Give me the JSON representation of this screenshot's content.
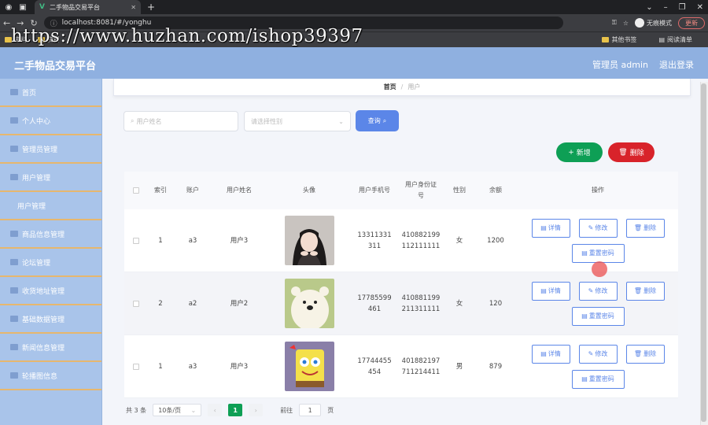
{
  "browser": {
    "tab_title": "二手物品交易平台",
    "url": "localhost:8081/#/yonghu",
    "incognito_label": "无痕模式",
    "update_label": "更新",
    "bookmarks": [
      "资料",
      "资料"
    ],
    "bookmarks_right": [
      "其他书签",
      "阅读清单"
    ]
  },
  "watermark": "https://www.huzhan.com/ishop39397",
  "header": {
    "brand": "二手物品交易平台",
    "user": "管理员 admin",
    "logout": "退出登录"
  },
  "sidebar": {
    "items": [
      {
        "label": "首页",
        "icon": "home-icon"
      },
      {
        "label": "个人中心",
        "icon": "user-icon"
      },
      {
        "label": "管理员管理",
        "icon": "admin-icon"
      },
      {
        "label": "用户管理",
        "icon": "users-icon"
      },
      {
        "label": "用户管理",
        "icon": ""
      },
      {
        "label": "商品信息管理",
        "icon": "goods-icon"
      },
      {
        "label": "论坛管理",
        "icon": "forum-icon"
      },
      {
        "label": "收货地址管理",
        "icon": "address-icon"
      },
      {
        "label": "基础数据管理",
        "icon": "data-icon"
      },
      {
        "label": "新闻信息管理",
        "icon": "news-icon"
      },
      {
        "label": "轮播图信息",
        "icon": "carousel-icon"
      }
    ]
  },
  "breadcrumb": {
    "home": "首页",
    "sep": "/",
    "current": "用户"
  },
  "filters": {
    "name_placeholder": "用户姓名",
    "gender_placeholder": "请选择性别",
    "query_label": "查询"
  },
  "actions": {
    "add_label": "新增",
    "delete_label": "删除"
  },
  "table": {
    "headers": [
      "索引",
      "账户",
      "用户姓名",
      "头像",
      "用户手机号",
      "用户身份证号",
      "性别",
      "余额",
      "操作"
    ],
    "rows": [
      {
        "index": "1",
        "account": "a3",
        "name": "用户3",
        "phone": "13311331311",
        "idcard": "410882199112111111",
        "gender": "女",
        "balance": "1200",
        "avatar": "girl-photo"
      },
      {
        "index": "2",
        "account": "a2",
        "name": "用户2",
        "phone": "17785599461",
        "idcard": "410881199211311111",
        "gender": "女",
        "balance": "120",
        "avatar": "bear-cartoon"
      },
      {
        "index": "1",
        "account": "a3",
        "name": "用户3",
        "phone": "17744455454",
        "idcard": "401882197711214411",
        "gender": "男",
        "balance": "879",
        "avatar": "spongebob-cartoon"
      }
    ],
    "row_actions": {
      "detail": "详情",
      "edit": "修改",
      "delete": "删除",
      "reset": "重置密码"
    }
  },
  "pagination": {
    "total": "共 3 条",
    "page_size": "10条/页",
    "current": "1",
    "goto_label": "前往",
    "goto_value": "1",
    "page_unit": "页"
  },
  "colors": {
    "header_bg": "#8fb0e0",
    "sidebar_bg": "#a9c4ea",
    "primary": "#5b86e8",
    "success": "#0e9f55",
    "danger": "#d8232a"
  }
}
